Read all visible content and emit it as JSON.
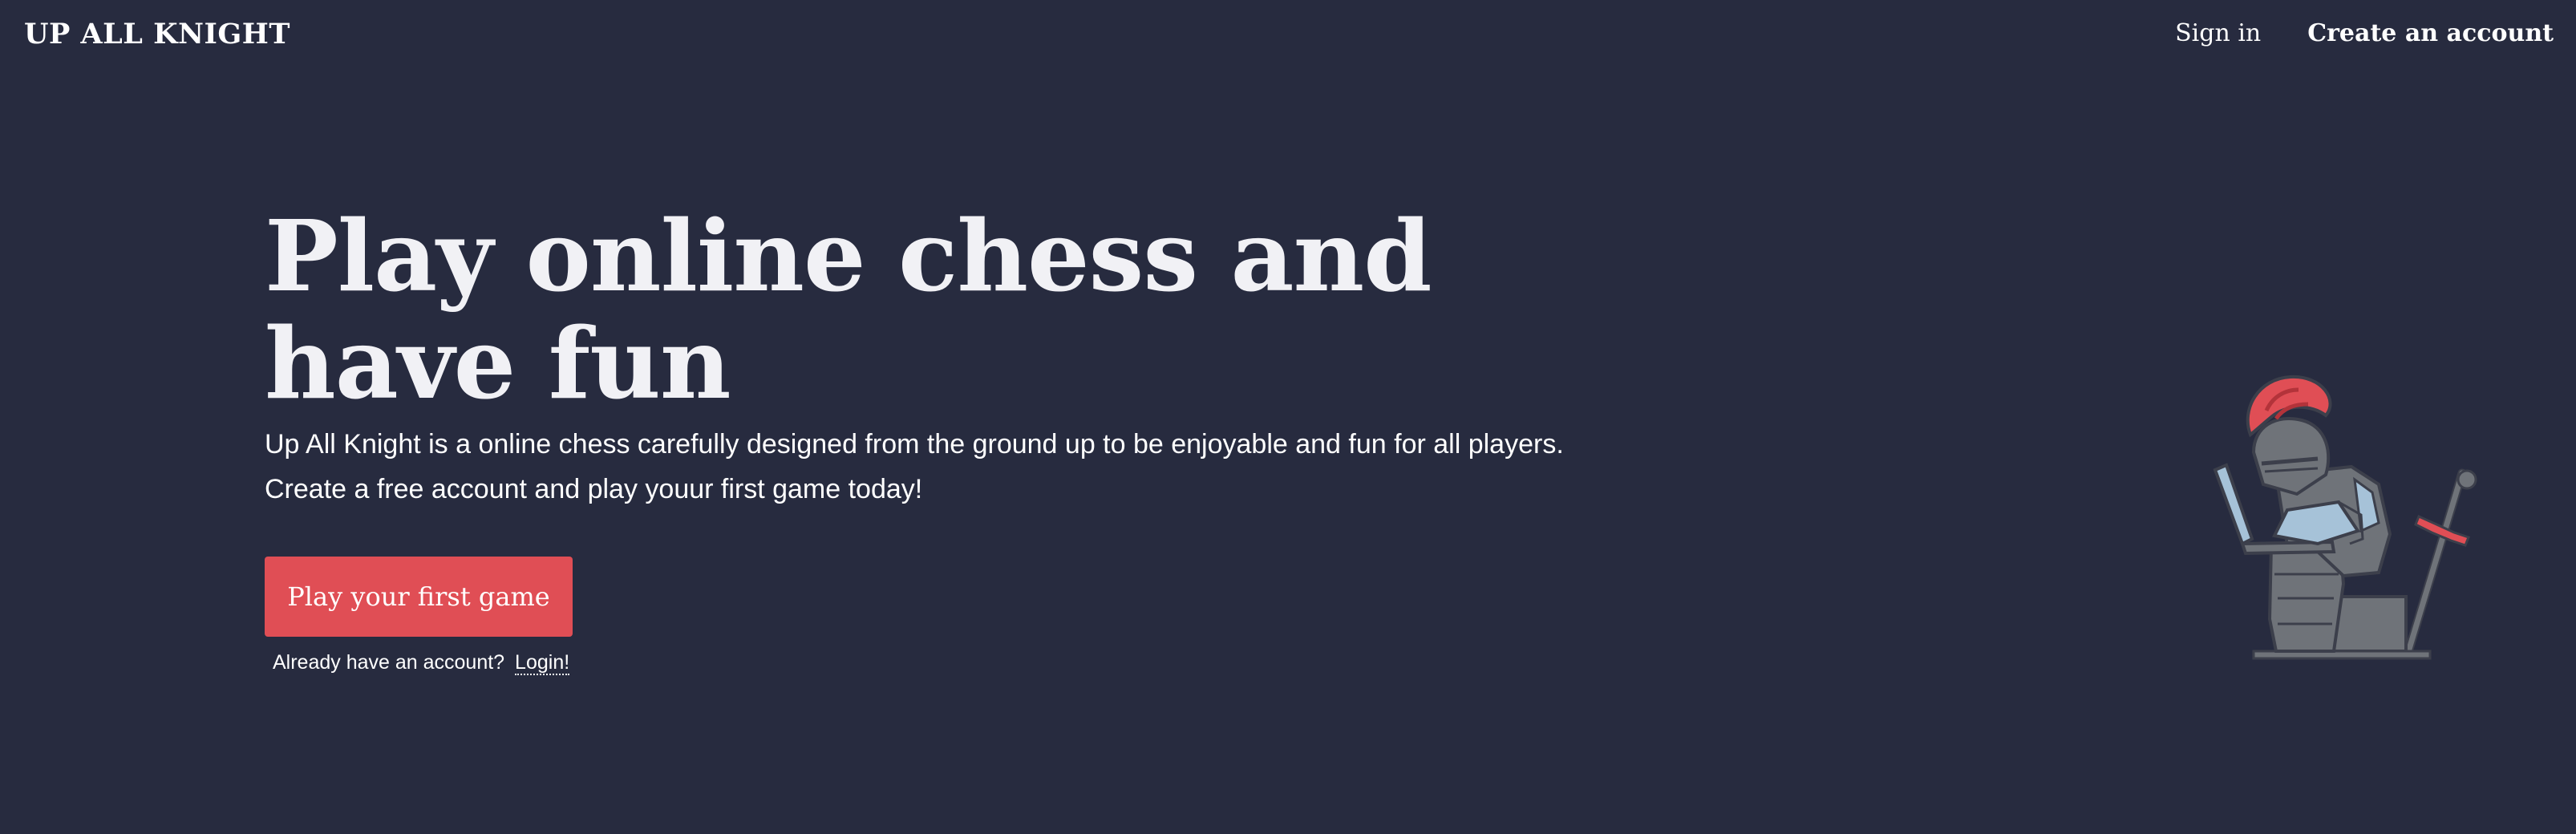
{
  "header": {
    "brand": "UP ALL KNIGHT",
    "nav": {
      "sign_in": "Sign in",
      "create_account": "Create an account"
    }
  },
  "hero": {
    "title": "Play online chess and have fun",
    "description": "Up All Knight is a online chess carefully designed from the ground up to be enjoyable and fun for all players. Create a free account and play youur first game today!",
    "cta_label": "Play your first game",
    "login_prompt": "Already have an account?",
    "login_link": "Login!"
  },
  "illustration": {
    "icon": "knight-with-laptop-illustration"
  },
  "colors": {
    "background": "#272b3f",
    "accent": "#e04e55",
    "text": "#ffffff",
    "armor": "#777a7f",
    "armor_highlight": "#a6c2d8"
  }
}
